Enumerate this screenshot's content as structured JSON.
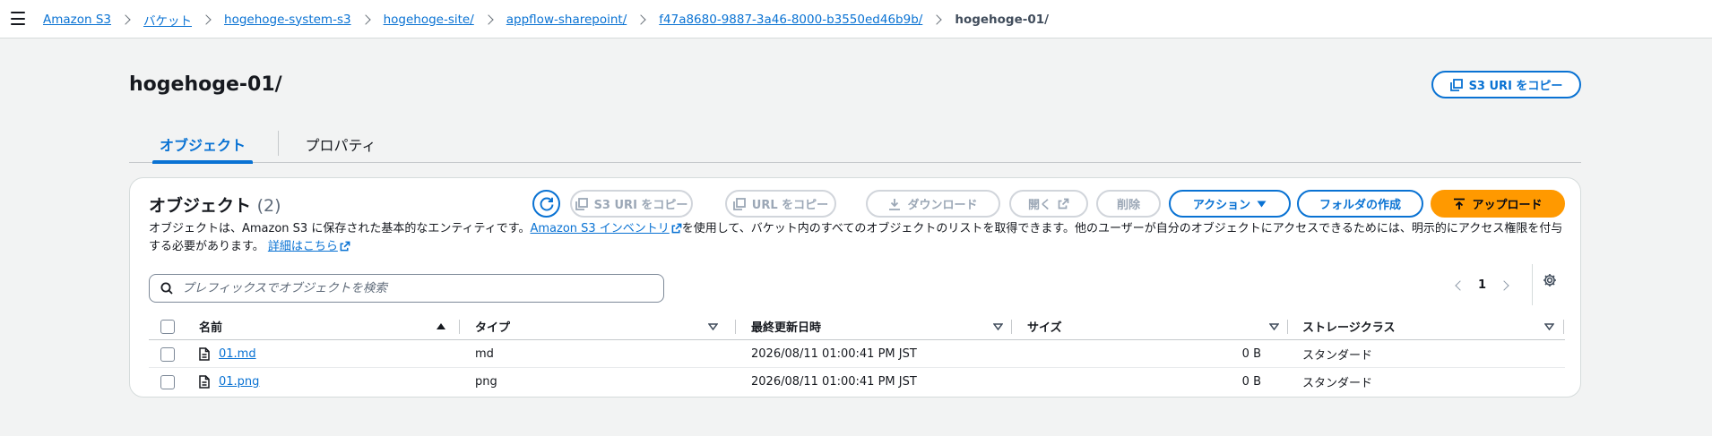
{
  "nav": {
    "menu_icon": "hamburger-icon",
    "breadcrumbs": [
      {
        "label": "Amazon S3"
      },
      {
        "label": "バケット"
      },
      {
        "label": "hogehoge-system-s3"
      },
      {
        "label": "hogehoge-site/"
      },
      {
        "label": "appflow-sharepoint/"
      },
      {
        "label": "f47a8680-9887-3a46-8000-b3550ed46b9b/"
      },
      {
        "label": "hogehoge-01/"
      }
    ]
  },
  "header": {
    "title": "hogehoge-01/",
    "copy_uri_label": "S3 URI をコピー"
  },
  "tabs": [
    {
      "label": "オブジェクト",
      "selected": true
    },
    {
      "label": "プロパティ",
      "selected": false
    }
  ],
  "objects_panel": {
    "title": "オブジェクト",
    "count": "(2)",
    "toolbar": {
      "refresh_icon": "refresh-icon",
      "copy_s3_uri": "S3 URI をコピー",
      "copy_url": "URL をコピー",
      "download": "ダウンロード",
      "open": "開く",
      "delete": "削除",
      "actions": "アクション",
      "create_folder": "フォルダの作成",
      "upload": "アップロード"
    },
    "description": {
      "part1": "オブジェクトは、Amazon S3 に保存された基本的なエンティティです。",
      "inventory_link": "Amazon S3 インベントリ",
      "part2": "を使用して、バケット内のすべてのオブジェクトのリストを取得できます。他のユーザーが自分のオブジェクトにアクセスできるためには、明示的にアクセス権限を付与する必要があります。",
      "details_link": "詳細はこちら"
    },
    "search": {
      "placeholder": "プレフィックスでオブジェクトを検索",
      "value": ""
    },
    "pagination": {
      "current_page": "1"
    },
    "table": {
      "columns": [
        "名前",
        "タイプ",
        "最終更新日時",
        "サイズ",
        "ストレージクラス"
      ],
      "rows": [
        {
          "name": "01.md",
          "type": "md",
          "modified": "2026/08/11 01:00:41 PM JST",
          "size": "0 B",
          "storage_class": "スタンダード"
        },
        {
          "name": "01.png",
          "type": "png",
          "modified": "2026/08/11 01:00:41 PM JST",
          "size": "0 B",
          "storage_class": "スタンダード"
        }
      ]
    }
  },
  "colors": {
    "link_blue": "#0972d3",
    "upload_orange": "#ff9900",
    "disabled_text": "#9ba7b6"
  }
}
